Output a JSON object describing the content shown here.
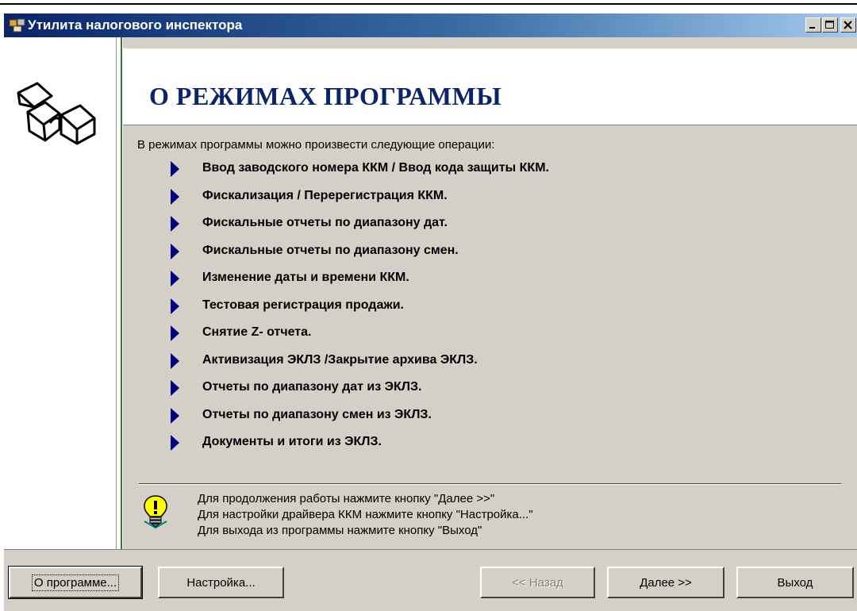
{
  "window": {
    "title": "Утилита налогового инспектора"
  },
  "header": {
    "title": "О РЕЖИМАХ ПРОГРАММЫ"
  },
  "intro": "В режимах программы можно произвести следующие операции:",
  "operations": [
    "Ввод заводского номера ККМ / Ввод кода защиты ККМ.",
    "Фискализация / Перерегистрация ККМ.",
    "Фискальные отчеты по диапазону дат.",
    "Фискальные отчеты по диапазону смен.",
    "Изменение даты и времени ККМ.",
    "Тестовая регистрация продажи.",
    "Снятие  Z- отчета.",
    "Активизация ЭКЛЗ /Закрытие архива ЭКЛЗ.",
    "Отчеты по диапазону дат из ЭКЛЗ.",
    "Отчеты по диапазону смен из ЭКЛЗ.",
    "Документы и итоги из ЭКЛЗ."
  ],
  "hints": [
    "Для продолжения работы нажмите кнопку \"Далее >>\"",
    "Для настройки драйвера ККМ нажмите кнопку \"Настройка...\"",
    "Для выхода из программы нажмите кнопку \"Выход\""
  ],
  "buttons": {
    "about": "О программе...",
    "settings": "Настройка...",
    "back": "<< Назад",
    "next": "Далее >>",
    "exit": "Выход"
  },
  "colors": {
    "title_bar": "#0a246a",
    "accent_line": "#2f7a2f",
    "arrow": "#000080"
  },
  "icons": {
    "app": "app-icon",
    "logo": "cubes-logo",
    "hint": "lightbulb-icon"
  }
}
